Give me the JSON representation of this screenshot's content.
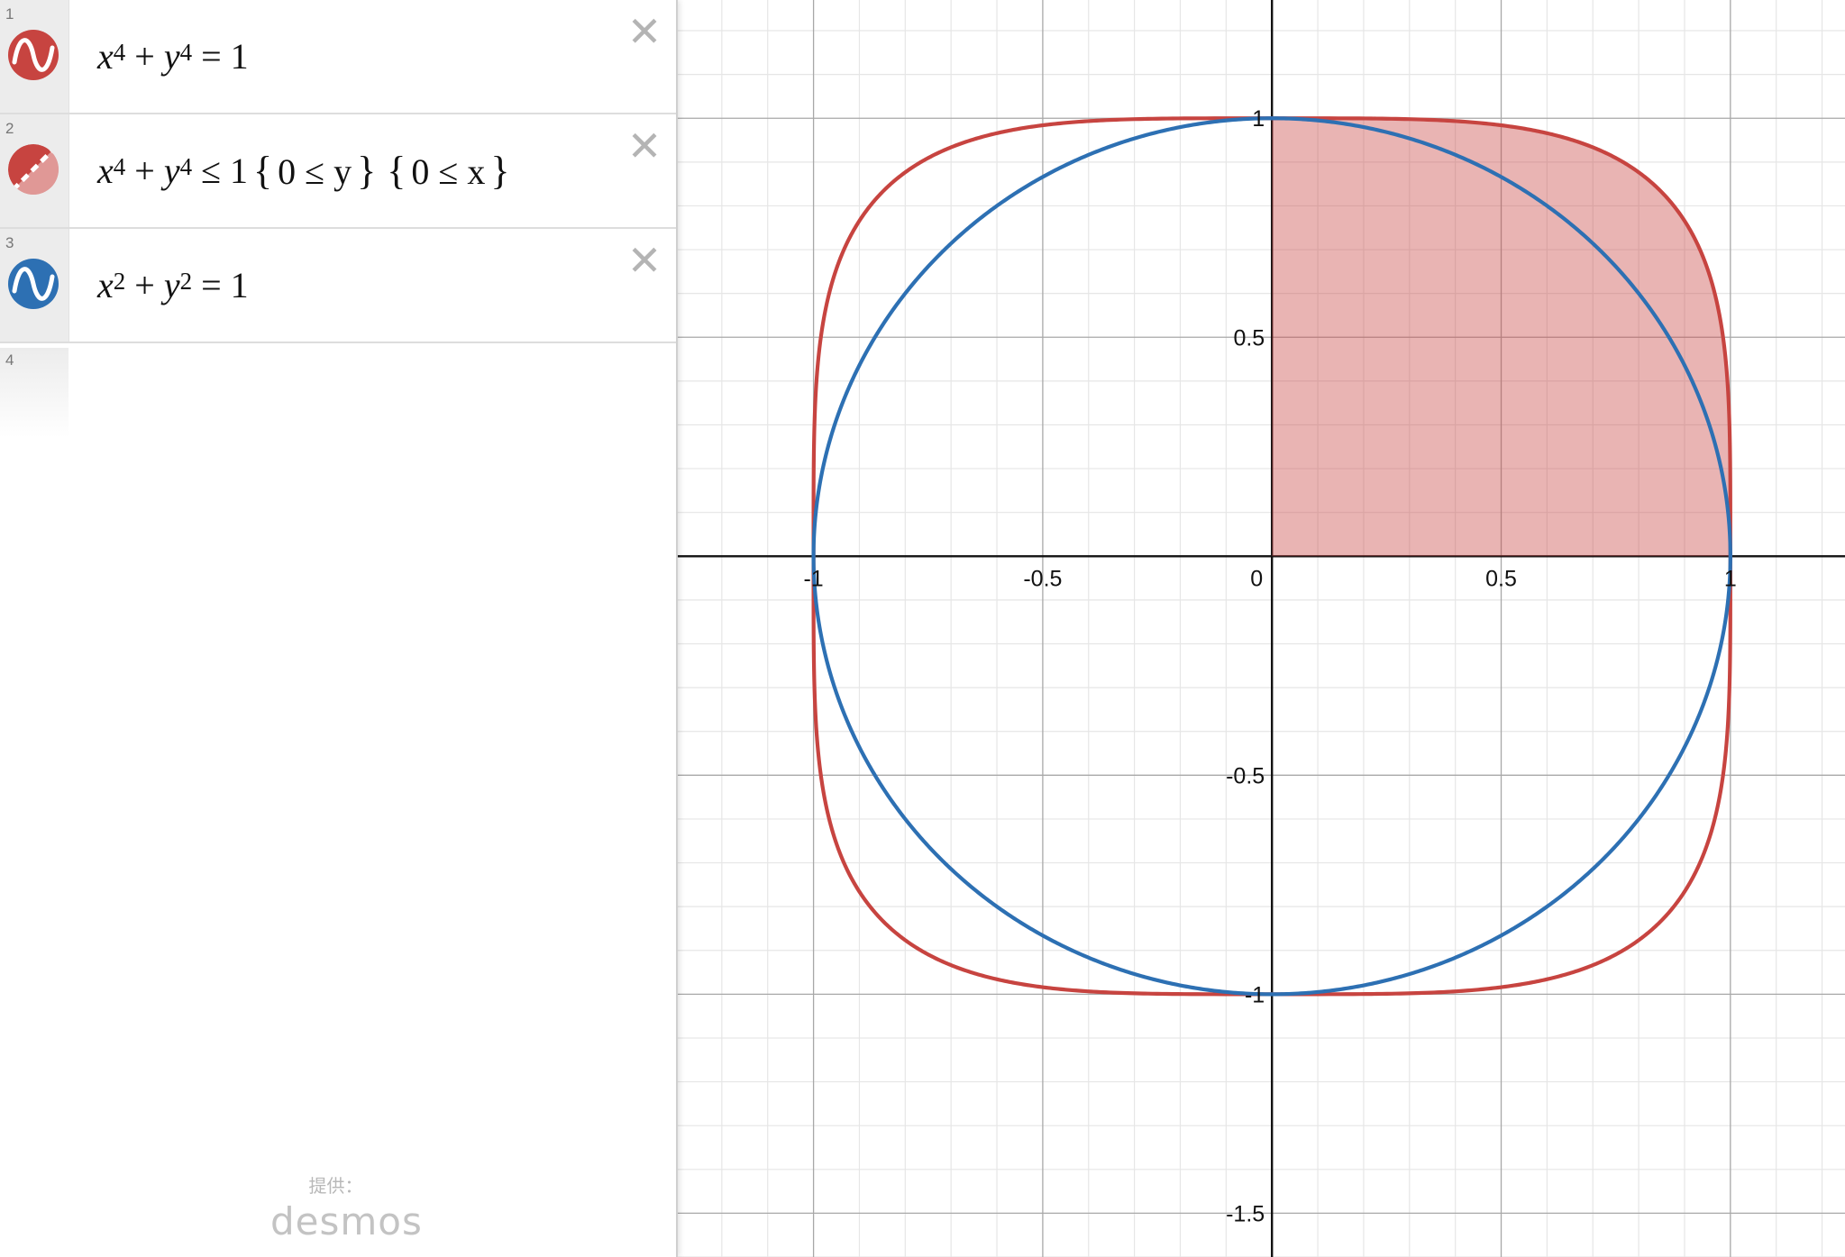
{
  "expressions": [
    {
      "index": "1",
      "color": "#c74440",
      "icon": "graph-wave-icon",
      "lhs": [
        {
          "base": "x",
          "exp": "4"
        },
        {
          "op": "+"
        },
        {
          "base": "y",
          "exp": "4"
        }
      ],
      "relation": "=",
      "rhs": "1",
      "restrictions": []
    },
    {
      "index": "2",
      "color": "#c74440",
      "icon": "shaded-region-icon",
      "lhs": [
        {
          "base": "x",
          "exp": "4"
        },
        {
          "op": "+"
        },
        {
          "base": "y",
          "exp": "4"
        }
      ],
      "relation": "≤",
      "rhs": "1",
      "restrictions": [
        "0 ≤ y",
        "0 ≤ x"
      ]
    },
    {
      "index": "3",
      "color": "#2d70b3",
      "icon": "graph-wave-icon",
      "lhs": [
        {
          "base": "x",
          "exp": "2"
        },
        {
          "op": "+"
        },
        {
          "base": "y",
          "exp": "2"
        }
      ],
      "relation": "=",
      "rhs": "1",
      "restrictions": []
    }
  ],
  "empty_row_index": "4",
  "delete_glyph": "✕",
  "powered_by": {
    "label": "提供：",
    "logo": "desmos"
  },
  "chart_data": {
    "type": "implicit-curves",
    "xlim": [
      -1.3,
      1.25
    ],
    "ylim": [
      -1.6,
      1.27
    ],
    "grid": true,
    "major_step": 0.5,
    "minor_step": 0.1,
    "x_tick_labels": [
      "-1",
      "-0.5",
      "0",
      "0.5",
      "1"
    ],
    "y_tick_labels": [
      "1",
      "0.5",
      "-0.5",
      "-1",
      "-1.5"
    ],
    "series": [
      {
        "equation": "x^4 + y^4 = 1",
        "color": "#c74440",
        "kind": "curve",
        "exponent": 4
      },
      {
        "equation": "x^4 + y^4 ≤ 1 {0 ≤ y} {0 ≤ x}",
        "color": "#c74440",
        "kind": "region",
        "exponent": 4,
        "fill_opacity": 0.4
      },
      {
        "equation": "x^2 + y^2 = 1",
        "color": "#2d70b3",
        "kind": "curve",
        "exponent": 2
      }
    ]
  }
}
